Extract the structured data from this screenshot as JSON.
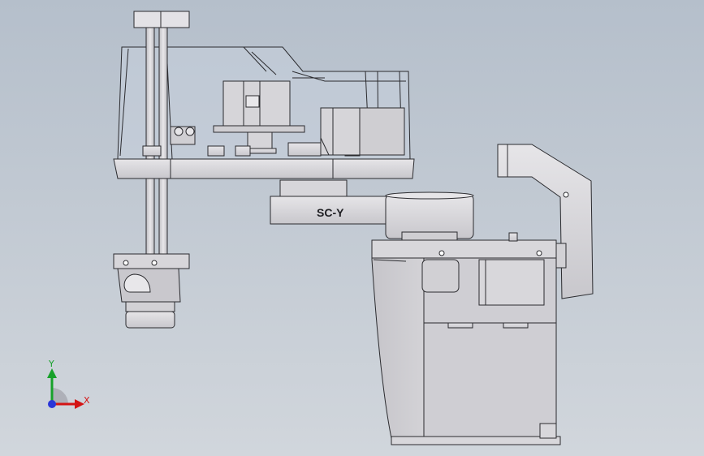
{
  "model": {
    "arm_label": "SC-Y",
    "description_colors": {
      "background_top": "#b7c0cc",
      "background_bottom": "#cfd5dc",
      "body_fill": "#d9d8db",
      "body_dark": "#bdbcc0",
      "edge": "#2b2b2f",
      "cover_fill": "#c9d0dc"
    }
  },
  "triad": {
    "x_label": "X",
    "y_label": "Y",
    "x_color": "#d41414",
    "y_color": "#17a12a",
    "z_color": "#2a36d8"
  }
}
